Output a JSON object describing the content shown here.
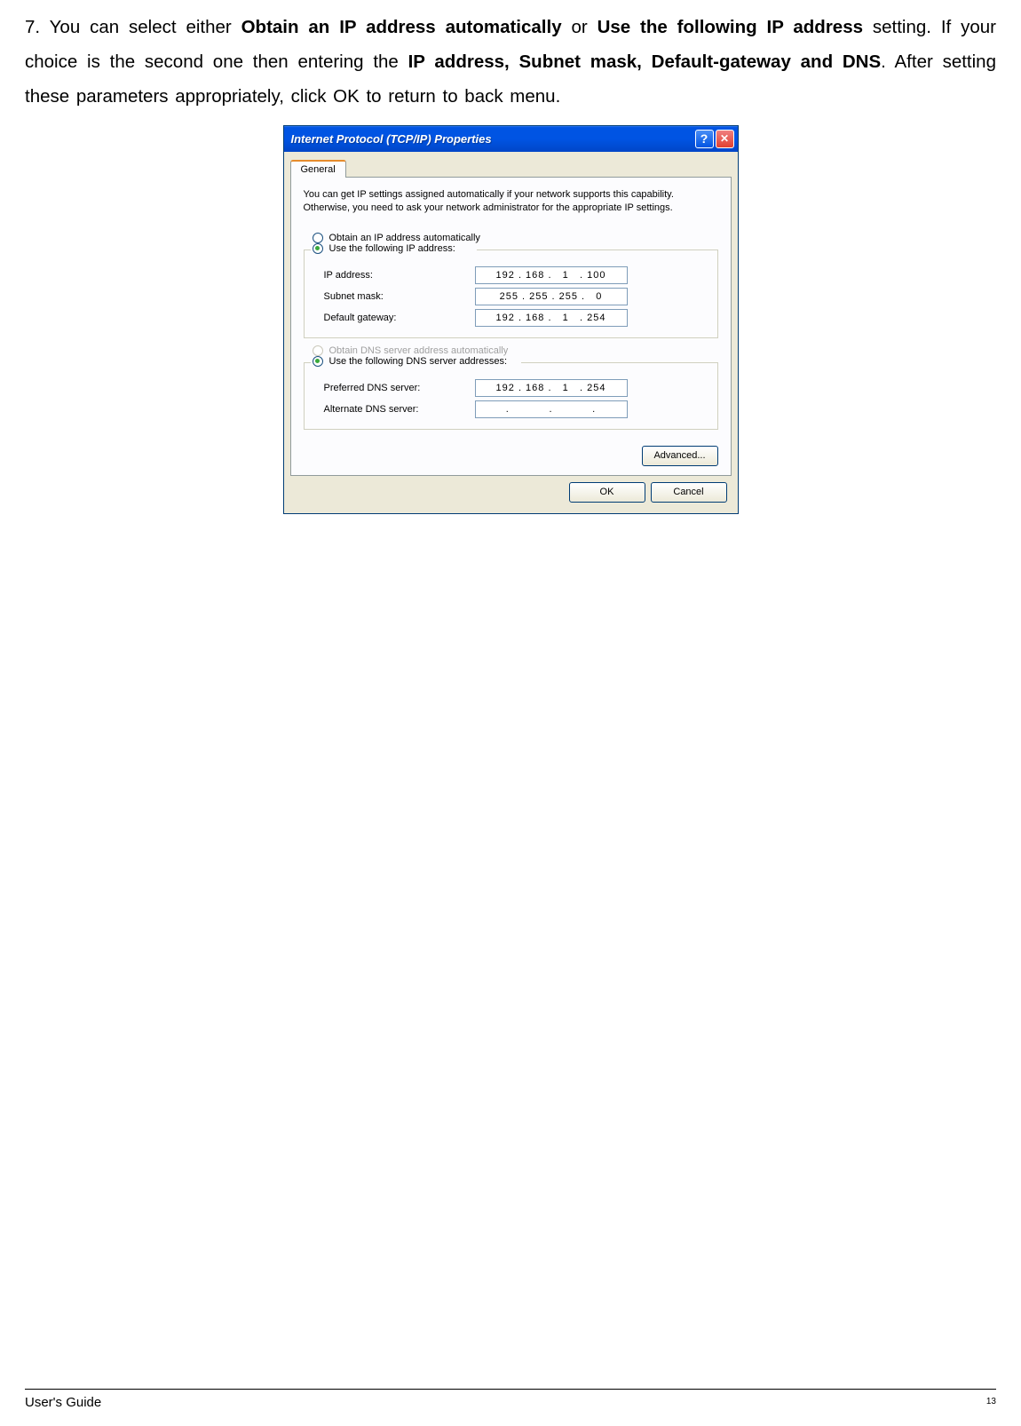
{
  "instruction": {
    "step": "7.",
    "t1": "You can select either ",
    "b1": "Obtain an IP address automatically",
    "t2": " or ",
    "b2": "Use the following IP address",
    "t3": " setting. If your choice is the second one then entering the ",
    "b3": "IP address, Subnet mask, Default-gateway and DNS",
    "t4": ". After setting these parameters appropriately, click OK to return to back menu."
  },
  "dialog": {
    "title": "Internet Protocol (TCP/IP) Properties",
    "tab": "General",
    "desc": "You can get IP settings assigned automatically if your network supports this capability. Otherwise, you need to ask your network administrator for the appropriate IP settings.",
    "radio_auto_ip": "Obtain an IP address automatically",
    "radio_use_ip": "Use the following IP address:",
    "ip_label": "IP address:",
    "ip_value": "192 . 168 .   1   . 100",
    "subnet_label": "Subnet mask:",
    "subnet_value": "255 . 255 . 255 .   0",
    "gateway_label": "Default gateway:",
    "gateway_value": "192 . 168 .   1   . 254",
    "radio_auto_dns": "Obtain DNS server address automatically",
    "radio_use_dns": "Use the following DNS server addresses:",
    "pref_dns_label": "Preferred DNS server:",
    "pref_dns_value": "192 . 168 .   1   . 254",
    "alt_dns_label": "Alternate DNS server:",
    "alt_dns_value": ".           .           .",
    "advanced_btn": "Advanced...",
    "ok_btn": "OK",
    "cancel_btn": "Cancel"
  },
  "footer": {
    "guide": "User's Guide",
    "page": "13"
  }
}
